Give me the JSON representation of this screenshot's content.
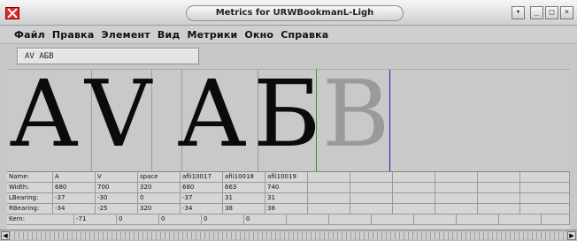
{
  "window": {
    "title": "Metrics for URWBookmanL-Ligh"
  },
  "menu": [
    "Файл",
    "Правка",
    "Элемент",
    "Вид",
    "Метрики",
    "Окно",
    "Справка"
  ],
  "text_field": {
    "value": "AV АБВ"
  },
  "preview_glyphs": [
    {
      "char": "A",
      "ghost": false
    },
    {
      "char": "V",
      "ghost": false
    },
    {
      "char": " ",
      "ghost": false
    },
    {
      "char": "А",
      "ghost": false
    },
    {
      "char": "Б",
      "ghost": false
    },
    {
      "char": "В",
      "ghost": true
    }
  ],
  "guides": {
    "left_color": "#2a9c2a",
    "right_color": "#2222aa"
  },
  "metrics": {
    "row_labels": {
      "name": "Name:",
      "width": "Width:",
      "lbearing": "LBearing:",
      "rbearing": "RBearing:",
      "kern": "Kern:"
    },
    "glyphs": [
      {
        "name": "A",
        "width": "680",
        "lbearing": "-37",
        "rbearing": "-34"
      },
      {
        "name": "V",
        "width": "700",
        "lbearing": "-30",
        "rbearing": "-25"
      },
      {
        "name": "space",
        "width": "320",
        "lbearing": "0",
        "rbearing": "320"
      },
      {
        "name": "afii10017",
        "width": "680",
        "lbearing": "-37",
        "rbearing": "-34"
      },
      {
        "name": "afii10018",
        "width": "663",
        "lbearing": "31",
        "rbearing": "38"
      },
      {
        "name": "afii10019",
        "width": "740",
        "lbearing": "31",
        "rbearing": "38"
      }
    ],
    "kern": [
      "-71",
      "0",
      "0",
      "0",
      "0"
    ]
  },
  "window_buttons": [
    "▾",
    "_",
    "□",
    "×"
  ]
}
